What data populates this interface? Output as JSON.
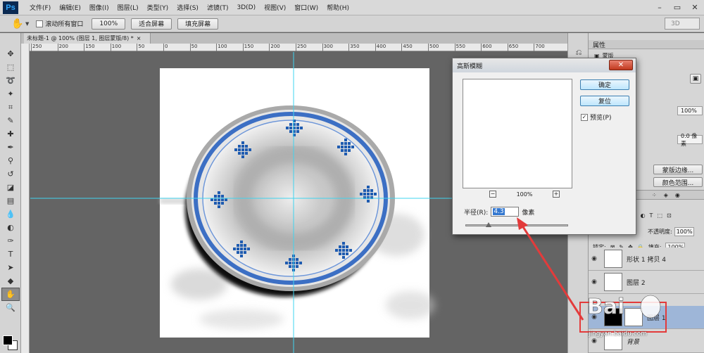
{
  "app": {
    "logo": "Ps"
  },
  "menu": [
    "文件(F)",
    "编辑(E)",
    "图像(I)",
    "图层(L)",
    "类型(Y)",
    "选择(S)",
    "滤镜(T)",
    "3D(D)",
    "视图(V)",
    "窗口(W)",
    "帮助(H)"
  ],
  "window_controls": {
    "minimize": "–",
    "restore": "▭",
    "close": "✕"
  },
  "options": {
    "scroll_all_label": "滚动所有窗口",
    "zoom_value": "100%",
    "fit_screen_label": "适合屏幕",
    "fill_screen_label": "填充屏幕",
    "workspace_value": "3D"
  },
  "document": {
    "tab_title": "未标题-1 @ 100% (图层 1, 图层蒙版/8) *",
    "tab_close": "×"
  },
  "ruler_h_ticks": [
    "250",
    "200",
    "150",
    "100",
    "50",
    "0",
    "50",
    "100",
    "150",
    "200",
    "250",
    "300",
    "350",
    "400",
    "450",
    "500",
    "550",
    "600",
    "650",
    "700"
  ],
  "dialog": {
    "title": "高斯模糊",
    "close_label": "✕",
    "ok_label": "确定",
    "reset_label": "复位",
    "preview_label": "预览(P)",
    "preview_checked": "✓",
    "zoom_minus": "−",
    "zoom_plus": "+",
    "zoom_level": "100%",
    "radius_label": "半径(R):",
    "radius_value": "4.3",
    "radius_unit": "像素",
    "radius_slider_fraction": 0.22
  },
  "properties": {
    "header": "属性",
    "mask_label": "蒙版",
    "density_value": "100%",
    "feather_value": "0.0 像素",
    "refine_edge_label": "蒙版边缘...",
    "color_range_label": "颜色范围..."
  },
  "layers_panel": {
    "opacity_label": "不透明度:",
    "opacity_value": "100%",
    "lock_label": "锁定:",
    "fill_label": "填充:",
    "fill_value": "100%",
    "layers": [
      {
        "name": "形状 1 拷贝 4",
        "selected": false
      },
      {
        "name": "图层 2",
        "selected": false
      },
      {
        "name": "图层 1",
        "selected": true
      },
      {
        "name": "背景",
        "selected": false
      }
    ]
  },
  "watermark": {
    "text": "jingyan.baidu.com"
  },
  "colors": {
    "plate_blue": "#3c6fc4",
    "pattern_blue": "#1e5bb0",
    "guide_cyan": "#3fd4ef",
    "annotation_red": "#e33b3b",
    "selected_layer": "#9eb6d8"
  }
}
